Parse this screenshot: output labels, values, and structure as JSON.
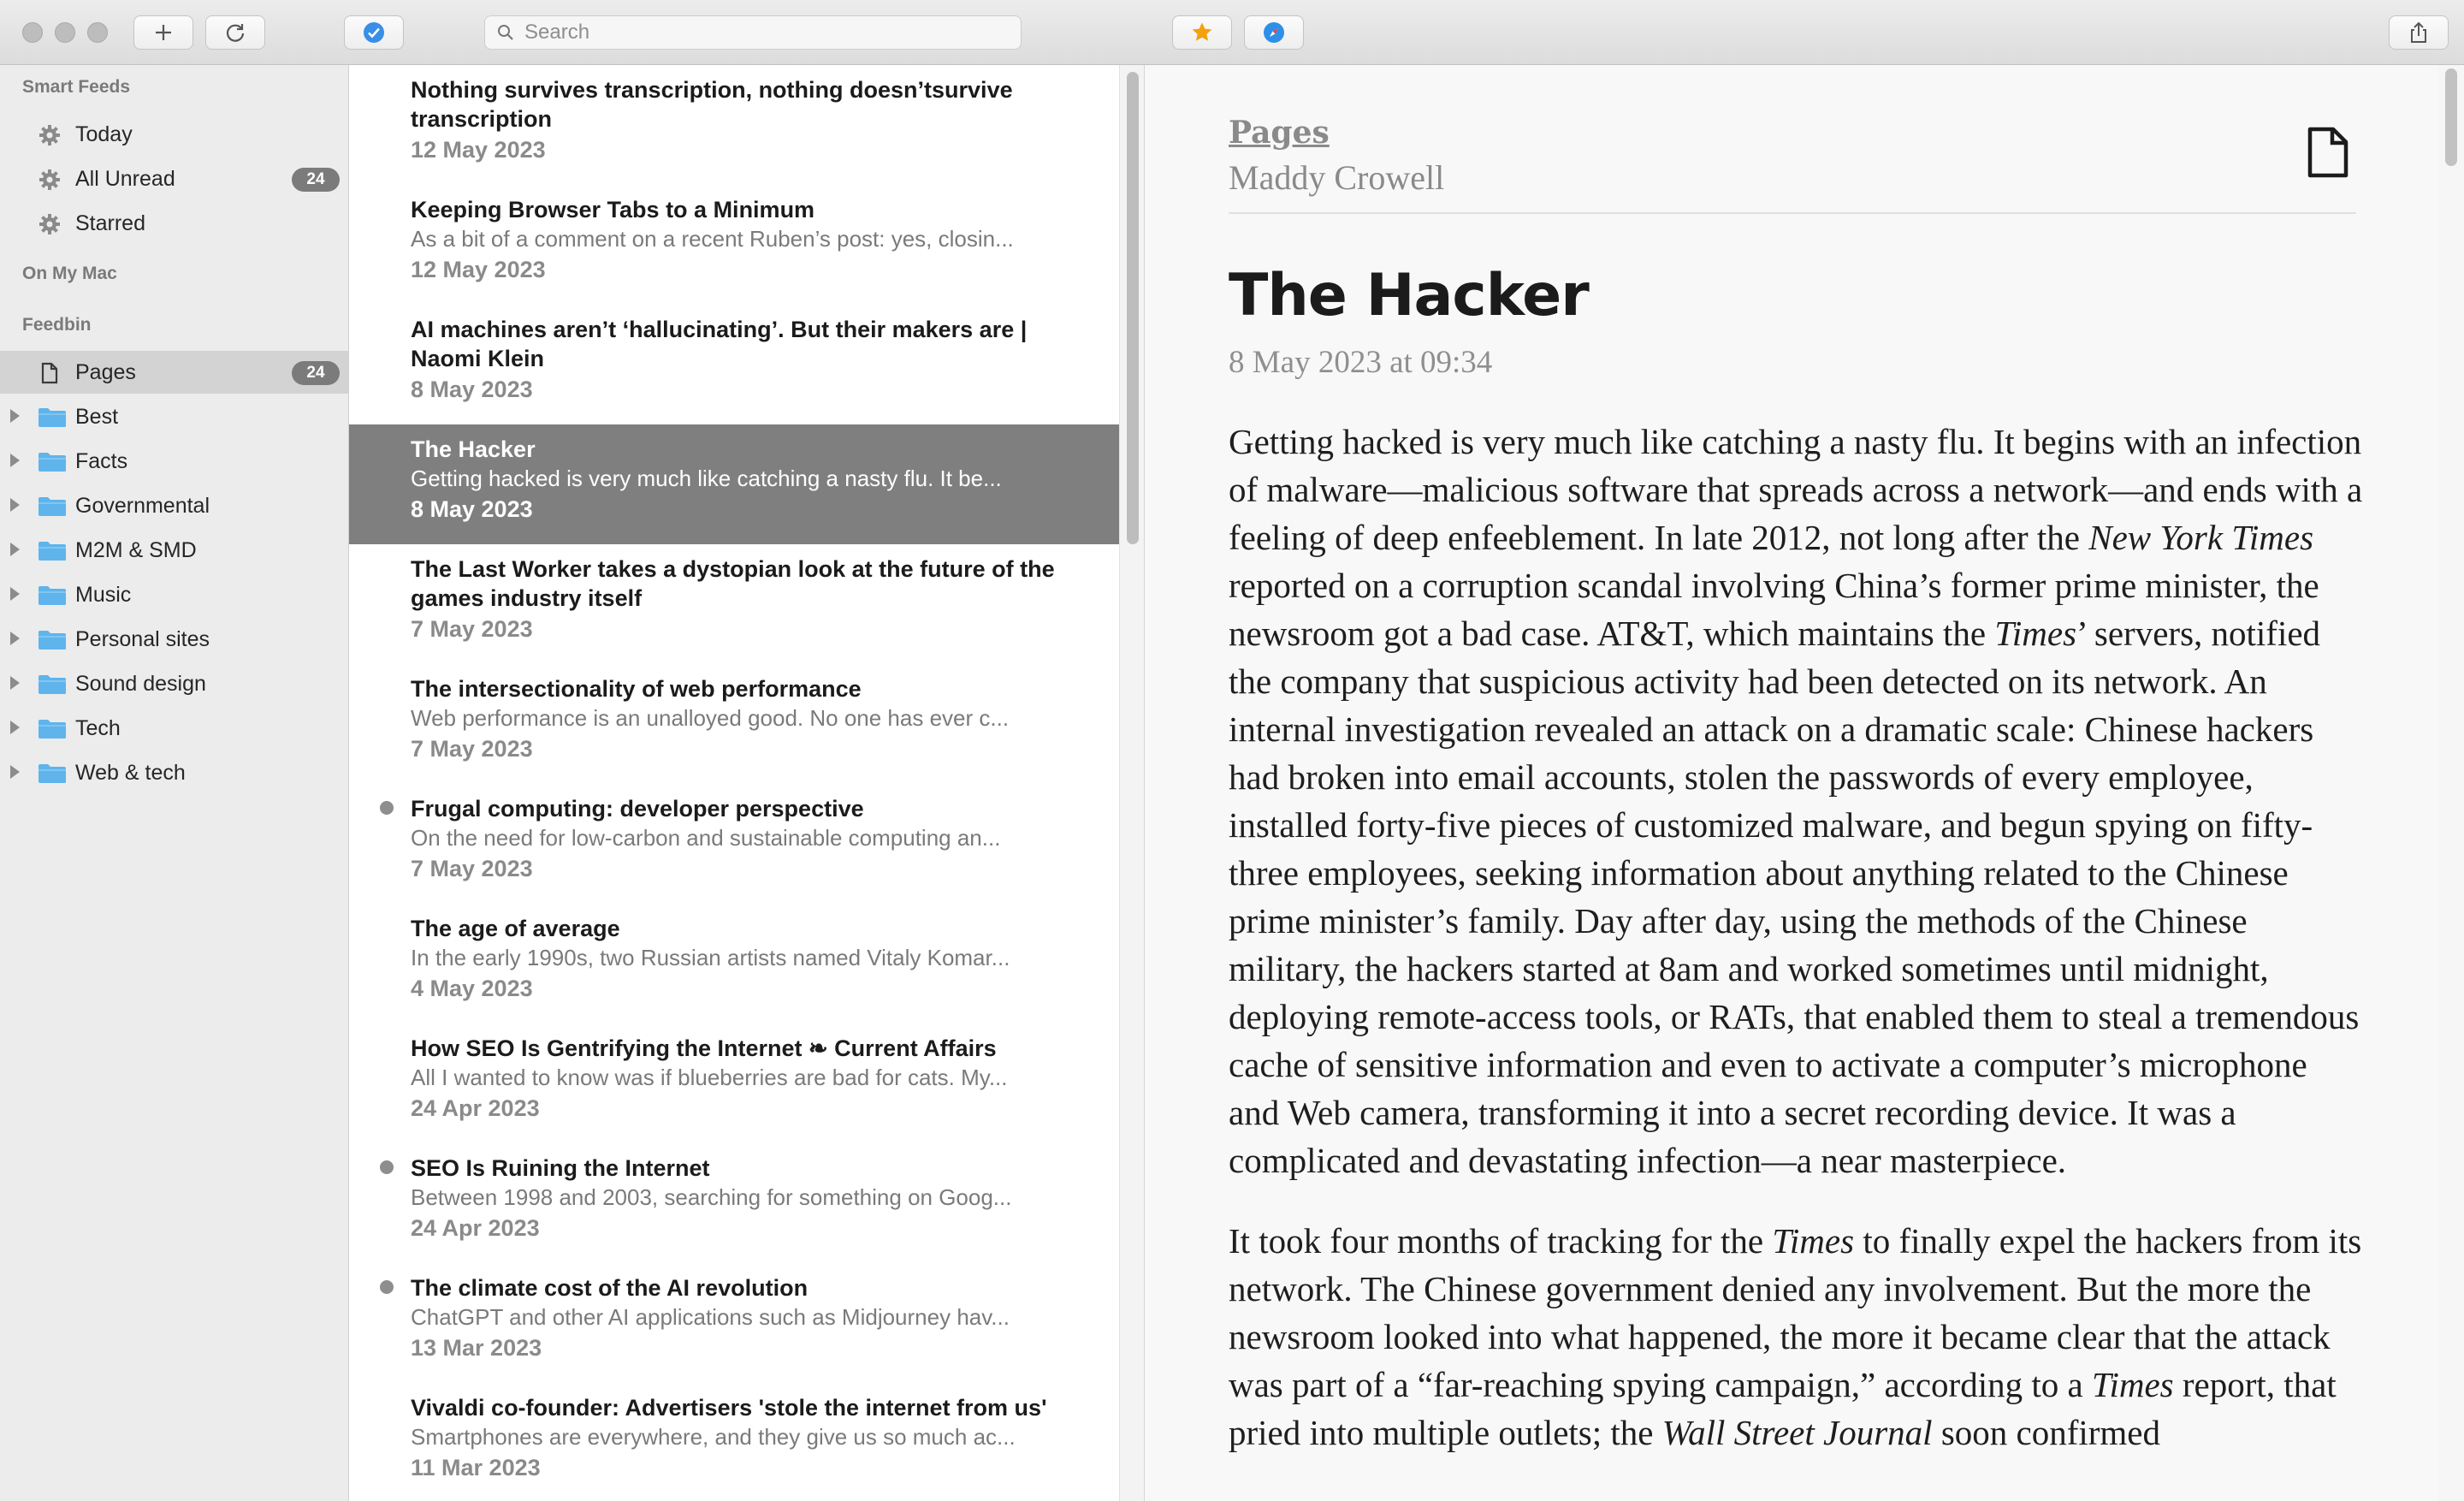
{
  "toolbar": {
    "search_placeholder": "Search"
  },
  "sidebar": {
    "smart_feeds_title": "Smart Feeds",
    "smart_feeds": [
      {
        "label": "Today",
        "count": ""
      },
      {
        "label": "All Unread",
        "count": "24"
      },
      {
        "label": "Starred",
        "count": ""
      }
    ],
    "on_my_mac_title": "On My Mac",
    "feedbin_title": "Feedbin",
    "pages": {
      "label": "Pages",
      "count": "24"
    },
    "folders": [
      {
        "label": "Best"
      },
      {
        "label": "Facts"
      },
      {
        "label": "Governmental"
      },
      {
        "label": "M2M & SMD"
      },
      {
        "label": "Music"
      },
      {
        "label": "Personal sites"
      },
      {
        "label": "Sound design"
      },
      {
        "label": "Tech"
      },
      {
        "label": "Web & tech"
      }
    ]
  },
  "articles": [
    {
      "title": "Nothing survives transcription, nothing doesn’tsurvive transcription",
      "snippet": "",
      "date": "12 May 2023",
      "unread": false,
      "selected": false
    },
    {
      "title": "Keeping Browser Tabs to a Minimum",
      "snippet": "As a bit of a comment on a recent Ruben’s post: yes, closin...",
      "date": "12 May 2023",
      "unread": false,
      "selected": false
    },
    {
      "title": "AI machines aren’t ‘hallucinating’. But their makers are | Naomi Klein",
      "snippet": "",
      "date": "8 May 2023",
      "unread": false,
      "selected": false
    },
    {
      "title": "The Hacker",
      "snippet": "Getting hacked is very much like catching a nasty flu. It be...",
      "date": "8 May 2023",
      "unread": false,
      "selected": true
    },
    {
      "title": "The Last Worker takes a dystopian look at the future of the games industry itself",
      "snippet": "",
      "date": "7 May 2023",
      "unread": false,
      "selected": false
    },
    {
      "title": "The intersectionality of web performance",
      "snippet": "Web performance is an unalloyed good. No one has ever c...",
      "date": "7 May 2023",
      "unread": false,
      "selected": false
    },
    {
      "title": "Frugal computing: developer perspective",
      "snippet": "On the need for low-carbon and sustainable computing an...",
      "date": "7 May 2023",
      "unread": true,
      "selected": false
    },
    {
      "title": "The age of average",
      "snippet": "In the early 1990s, two Russian artists named Vitaly Komar...",
      "date": "4 May 2023",
      "unread": false,
      "selected": false
    },
    {
      "title": "How SEO Is Gentrifying the Internet ❧ Current Affairs",
      "snippet": "All I wanted to know was if blueberries are bad for cats. My...",
      "date": "24 Apr 2023",
      "unread": false,
      "selected": false
    },
    {
      "title": "SEO Is Ruining the Internet",
      "snippet": "Between 1998 and 2003, searching for something on Goog...",
      "date": "24 Apr 2023",
      "unread": true,
      "selected": false
    },
    {
      "title": "The climate cost of the AI revolution",
      "snippet": "ChatGPT and other AI applications such as Midjourney hav...",
      "date": "13 Mar 2023",
      "unread": true,
      "selected": false
    },
    {
      "title": "Vivaldi co-founder: Advertisers 'stole the internet from us'",
      "snippet": "Smartphones are everywhere, and they give us so much ac...",
      "date": "11 Mar 2023",
      "unread": false,
      "selected": false
    }
  ],
  "reader": {
    "feed_name": "Pages",
    "author": "Maddy Crowell",
    "title": "The Hacker",
    "date": "8 May 2023 at 09:34",
    "paragraphs": [
      [
        {
          "t": "Getting hacked is very much like catching a nasty flu. It begins with an infection of malware—malicious software that spreads across a network—and ends with a feeling of deep enfeeblement. In late 2012, not long after the "
        },
        {
          "t": "New York Times",
          "i": true
        },
        {
          "t": " reported on a corruption scandal involving China’s former prime minister, the newsroom got a bad case. AT&T, which maintains the "
        },
        {
          "t": "Times",
          "i": true
        },
        {
          "t": "’ servers, notified the company that suspicious activity had been detected on its network. An internal investigation revealed an attack on a dramatic scale: Chinese hackers had broken into email accounts, stolen the passwords of every employee, installed forty-five pieces of customized malware, and begun spying on fifty-three employees, seeking information about anything related to the Chinese prime minister’s family. Day after day, using the methods of the Chinese military, the hackers started at 8am and worked sometimes until midnight, deploying remote-access tools, or RATs, that enabled them to steal a tremendous cache of sensitive information and even to activate a computer’s microphone and Web camera, transforming it into a secret recording device. It was a complicated and devastating infection—a near masterpiece."
        }
      ],
      [
        {
          "t": "It took four months of tracking for the "
        },
        {
          "t": "Times",
          "i": true
        },
        {
          "t": " to finally expel the hackers from its network. The Chinese government denied any involvement. But the more the newsroom looked into what happened, the more it became clear that the attack was part of a “far-reaching spying campaign,” according to a "
        },
        {
          "t": "Times",
          "i": true
        },
        {
          "t": " report, that pried into multiple outlets; the "
        },
        {
          "t": "Wall Street Journal",
          "i": true
        },
        {
          "t": " soon confirmed"
        }
      ]
    ]
  }
}
